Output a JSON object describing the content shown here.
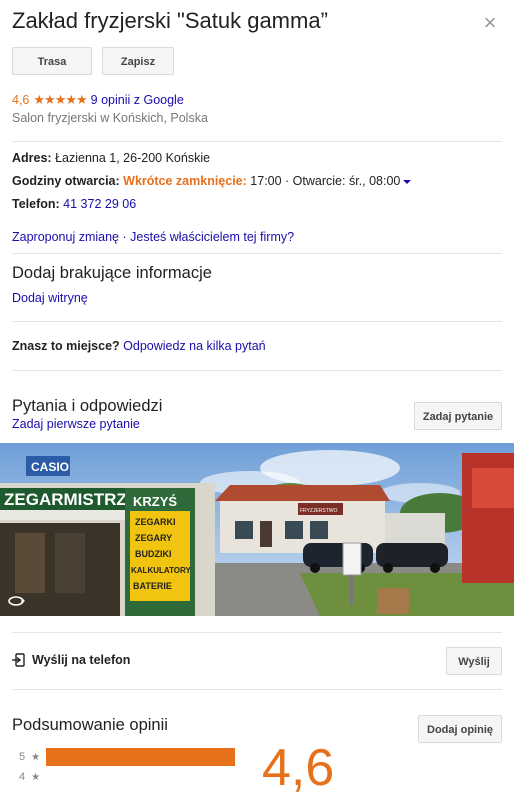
{
  "place": {
    "title": "Zakład fryzjerski \"Satuk gamma”",
    "close_label": "×"
  },
  "actions": {
    "route_label": "Trasa",
    "save_label": "Zapisz"
  },
  "rating": {
    "value": "4,6",
    "stars": "★★★★★",
    "reviews_link": "9 opinii z Google",
    "category": "Salon fryzjerski w Końskich, Polska"
  },
  "details": {
    "address_label": "Adres:",
    "address_value": "Łazienna 1, 26-200 Końskie",
    "hours_label": "Godziny otwarcia:",
    "hours_status": "Wkrótce zamknięcie:",
    "hours_value": "17:00 · Otwarcie: śr., 08:00",
    "phone_label": "Telefon:",
    "phone_value": "41 372 29 06"
  },
  "edit": {
    "suggest_link": "Zaproponuj zmianę",
    "separator": "·",
    "owner_link": "Jesteś właścicielem tej firmy?"
  },
  "missing": {
    "heading": "Dodaj brakujące informacje",
    "website_link": "Dodaj witrynę"
  },
  "know": {
    "question": "Znasz to miejsce?",
    "answer_link": "Odpowiedz na kilka pytań"
  },
  "qa": {
    "heading": "Pytania i odpowiedzi",
    "first_question_link": "Zadaj pierwsze pytanie",
    "ask_button": "Zadaj pytanie"
  },
  "photo": {
    "sign_casio": "CASIO",
    "sign_store": "ZEGARMISTRZ",
    "sign_krzys": "KRZYŚ",
    "sign_lines": [
      "ZEGARKI",
      "ZEGARY",
      "BUDZIKI",
      "KALKULATORY",
      "BATERIE"
    ],
    "sign_building": "FRYZJERSTWO"
  },
  "send": {
    "label": "Wyślij na telefon",
    "button": "Wyślij"
  },
  "reviews": {
    "heading": "Podsumowanie opinii",
    "write_button": "Dodaj opinię",
    "bars": [
      {
        "stars": "5",
        "fraction": 0.9
      },
      {
        "stars": "4",
        "fraction": 0.0
      }
    ],
    "big_value": "4,6"
  },
  "colors": {
    "accent": "#e7711b",
    "link": "#1a0dab"
  }
}
